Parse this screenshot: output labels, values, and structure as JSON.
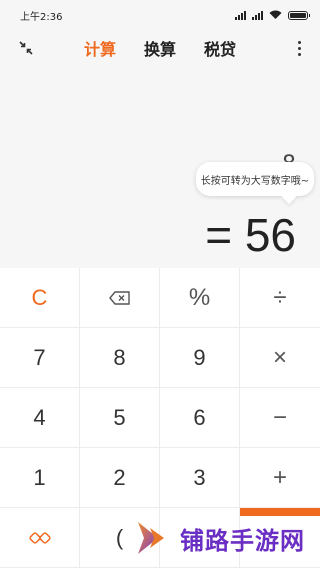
{
  "status": {
    "time": "上午2:36"
  },
  "tabs": [
    {
      "label": "计算",
      "active": true
    },
    {
      "label": "换算",
      "active": false
    },
    {
      "label": "税贷",
      "active": false
    }
  ],
  "display": {
    "partial_expression": "8",
    "tooltip": "长按可转为大写数字哦~",
    "result": "= 56"
  },
  "keys": [
    {
      "label": "C",
      "name": "clear-key",
      "style": "accent"
    },
    {
      "label": "",
      "name": "backspace-key",
      "style": "icon"
    },
    {
      "label": "%",
      "name": "percent-key",
      "style": "op"
    },
    {
      "label": "÷",
      "name": "divide-key",
      "style": "op"
    },
    {
      "label": "7",
      "name": "digit-7-key",
      "style": "digit"
    },
    {
      "label": "8",
      "name": "digit-8-key",
      "style": "digit"
    },
    {
      "label": "9",
      "name": "digit-9-key",
      "style": "digit"
    },
    {
      "label": "×",
      "name": "multiply-key",
      "style": "op"
    },
    {
      "label": "4",
      "name": "digit-4-key",
      "style": "digit"
    },
    {
      "label": "5",
      "name": "digit-5-key",
      "style": "digit"
    },
    {
      "label": "6",
      "name": "digit-6-key",
      "style": "digit"
    },
    {
      "label": "−",
      "name": "minus-key",
      "style": "op"
    },
    {
      "label": "1",
      "name": "digit-1-key",
      "style": "digit"
    },
    {
      "label": "2",
      "name": "digit-2-key",
      "style": "digit"
    },
    {
      "label": "3",
      "name": "digit-3-key",
      "style": "digit"
    },
    {
      "label": "+",
      "name": "plus-key",
      "style": "op"
    },
    {
      "label": "",
      "name": "switch-mode-key",
      "style": "icon"
    },
    {
      "label": "(",
      "name": "paren-key",
      "style": "digit"
    },
    {
      "label": "",
      "name": "empty-key",
      "style": "digit"
    },
    {
      "label": "",
      "name": "equals-key",
      "style": "digit"
    }
  ],
  "watermark": {
    "text": "铺路手游网"
  },
  "colors": {
    "accent": "#ef6a1f",
    "watermark": "#6a2ec4"
  }
}
